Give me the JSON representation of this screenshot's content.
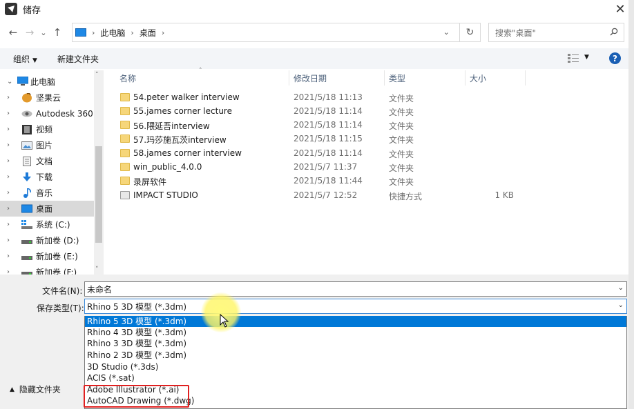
{
  "window": {
    "title": "储存",
    "close_glyph": "✕"
  },
  "nav_buttons": {
    "back": "←",
    "forward": "→",
    "recent": "⌄",
    "up": "↑"
  },
  "address": {
    "crumbs": [
      "此电脑",
      "桌面"
    ],
    "separator": "›",
    "dropdown": "⌄",
    "refresh": "↻"
  },
  "search": {
    "placeholder": "搜索\"桌面\""
  },
  "toolbar": {
    "organize": "组织",
    "organize_caret": "▼",
    "new_folder": "新建文件夹",
    "view_caret": "▼",
    "help": "?"
  },
  "sidebar": {
    "items": [
      {
        "label": "此电脑",
        "icon": "computer-icon",
        "expanded": true
      },
      {
        "label": "坚果云",
        "icon": "nutstore-icon"
      },
      {
        "label": "Autodesk 360",
        "icon": "cloud-eye-icon"
      },
      {
        "label": "视频",
        "icon": "video-icon"
      },
      {
        "label": "图片",
        "icon": "pictures-icon"
      },
      {
        "label": "文档",
        "icon": "documents-icon"
      },
      {
        "label": "下载",
        "icon": "download-icon"
      },
      {
        "label": "音乐",
        "icon": "music-icon"
      },
      {
        "label": "桌面",
        "icon": "desktop-icon",
        "selected": true
      },
      {
        "label": "系统 (C:)",
        "icon": "system-drive-icon"
      },
      {
        "label": "新加卷 (D:)",
        "icon": "drive-icon"
      },
      {
        "label": "新加卷 (E:)",
        "icon": "drive-icon"
      },
      {
        "label": "新加卷 (F:)",
        "icon": "drive-icon"
      }
    ],
    "scroll_up": "˄",
    "scroll_down": "˅"
  },
  "columns": {
    "name": "名称",
    "date": "修改日期",
    "type": "类型",
    "size": "大小",
    "sort_caret": "˄"
  },
  "files": [
    {
      "name": "54.peter walker interview",
      "date": "2021/5/18 11:13",
      "type": "文件夹",
      "size": ""
    },
    {
      "name": "55.james corner lecture",
      "date": "2021/5/18 11:14",
      "type": "文件夹",
      "size": ""
    },
    {
      "name": "56.隈延吾interview",
      "date": "2021/5/18 11:14",
      "type": "文件夹",
      "size": ""
    },
    {
      "name": "57.玛莎施瓦茨interview",
      "date": "2021/5/18 11:15",
      "type": "文件夹",
      "size": ""
    },
    {
      "name": "58.james corner interview",
      "date": "2021/5/18 11:14",
      "type": "文件夹",
      "size": ""
    },
    {
      "name": "win_public_4.0.0",
      "date": "2021/5/7 11:37",
      "type": "文件夹",
      "size": ""
    },
    {
      "name": "录屏软件",
      "date": "2021/5/18 11:44",
      "type": "文件夹",
      "size": ""
    },
    {
      "name": "IMPACT STUDIO",
      "date": "2021/5/7 12:52",
      "type": "快捷方式",
      "size": "1 KB",
      "shortcut": true
    }
  ],
  "form": {
    "filename_label": "文件名(N):",
    "filename_value": "未命名",
    "filetype_label": "保存类型(T):",
    "filetype_value": "Rhino 5 3D 模型 (*.3dm)",
    "dropdown_glyph": "⌄"
  },
  "filetype_options": [
    {
      "label": "Rhino 5 3D 模型 (*.3dm)",
      "selected": true
    },
    {
      "label": "Rhino 4 3D 模型 (*.3dm)"
    },
    {
      "label": "Rhino 3 3D 模型 (*.3dm)"
    },
    {
      "label": "Rhino 2 3D 模型 (*.3dm)"
    },
    {
      "label": "3D Studio (*.3ds)"
    },
    {
      "label": "ACIS (*.sat)"
    },
    {
      "label": "Adobe Illustrator (*.ai)"
    },
    {
      "label": "AutoCAD Drawing (*.dwg)"
    }
  ],
  "hide_folders": {
    "label": "隐藏文件夹",
    "caret": "▲"
  },
  "colors": {
    "selection": "#0078d7",
    "highlight_box": "#e02020",
    "folder": "#f6d67a"
  }
}
